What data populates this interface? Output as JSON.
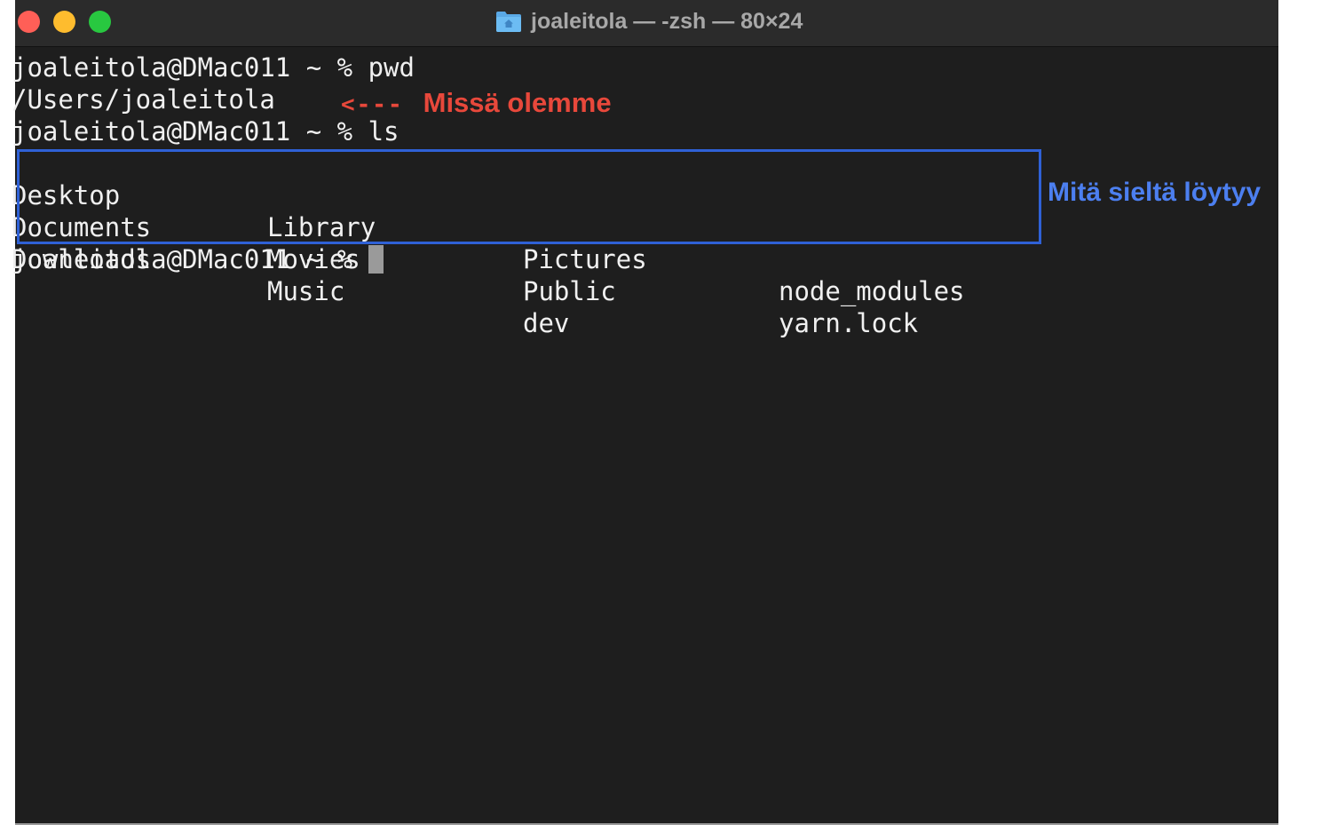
{
  "window": {
    "title": "joaleitola — -zsh — 80×24",
    "title_icon": "home-folder-icon",
    "colors": {
      "background": "#1e1e1e",
      "titlebar": "#2b2b2b",
      "text": "#f0f0f0",
      "close": "#ff5f57",
      "minimize": "#febc2e",
      "maximize": "#28c840"
    }
  },
  "terminal": {
    "lines": [
      "joaleitola@DMac011 ~ % pwd",
      "/Users/joaleitola",
      "joaleitola@DMac011 ~ % ls"
    ],
    "ls_rows": [
      [
        "Desktop",
        "Library",
        "Pictures",
        "node_modules"
      ],
      [
        "Documents",
        "Movies",
        "Public",
        "yarn.lock"
      ],
      [
        "Downloads",
        "Music",
        "dev",
        ""
      ]
    ],
    "prompt": "joaleitola@DMac011 ~ %"
  },
  "annotations": {
    "pwd_arrow": "<---",
    "pwd_label": "Missä olemme",
    "ls_label": "Mitä sieltä löytyy",
    "colors": {
      "pwd": "#e8483b",
      "ls": "#2f61d6"
    }
  }
}
